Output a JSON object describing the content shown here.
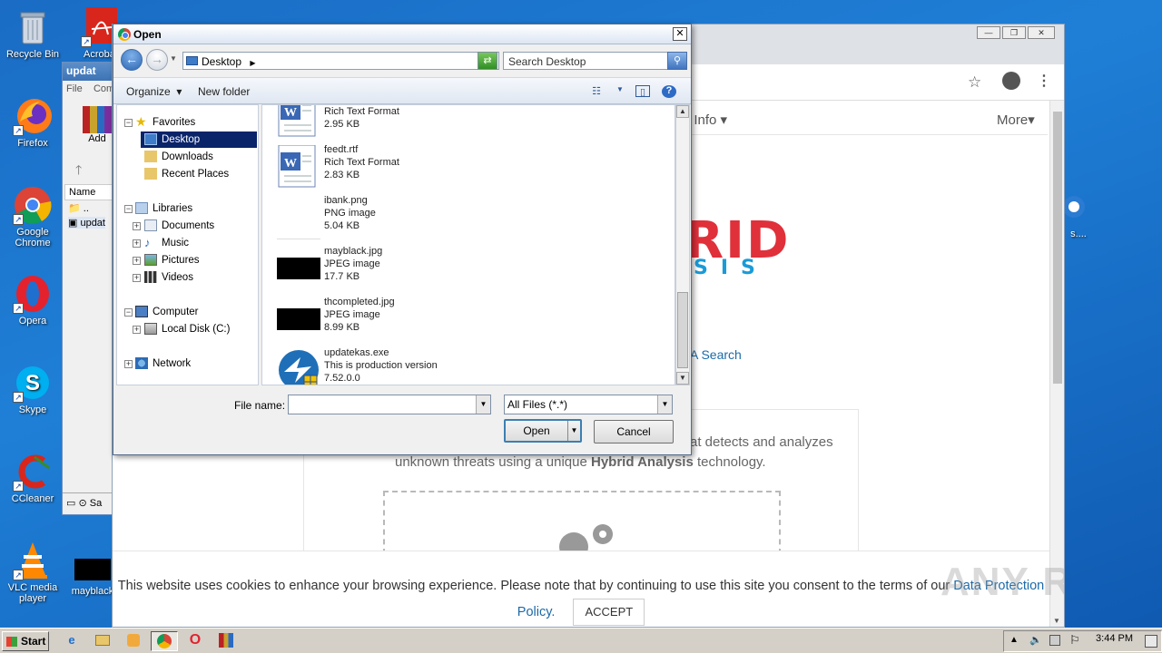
{
  "desktop": {
    "icons": [
      {
        "label": "Recycle Bin"
      },
      {
        "label": "Acrobat"
      },
      {
        "label": "Firefox"
      },
      {
        "label": "Google Chrome"
      },
      {
        "label": "Opera"
      },
      {
        "label": "Skype"
      },
      {
        "label": "CCleaner"
      },
      {
        "label": "VLC media player"
      },
      {
        "label": "mayblack"
      }
    ]
  },
  "winrar": {
    "title": "updat",
    "menu": [
      "File",
      "Com"
    ],
    "add_label": "Add",
    "col_name": "Name",
    "row1": "..",
    "row2": "updat",
    "status": "Sa"
  },
  "browser": {
    "nav_item": "t Info",
    "more": "More",
    "logo_text": "RID",
    "logo_sub": "SIS",
    "search_link": "A Search",
    "desc_line1": "at detects and analyzes",
    "desc_line2a": "unknown threats using a unique ",
    "desc_bold": "Hybrid Analysis",
    "desc_line2b": " technology.",
    "cookie_text": "This website uses cookies to enhance your browsing experience. Please note that by continuing to use this site you consent to the terms of our ",
    "cookie_link": "Data Protection Policy.",
    "accept": "ACCEPT",
    "watermark": "ANY RUN"
  },
  "dialog": {
    "title": "Open",
    "location": "Desktop",
    "search_placeholder": "Search Desktop",
    "organize": "Organize",
    "new_folder": "New folder",
    "tree": {
      "favorites": "Favorites",
      "desktop": "Desktop",
      "downloads": "Downloads",
      "recent": "Recent Places",
      "libraries": "Libraries",
      "documents": "Documents",
      "music": "Music",
      "pictures": "Pictures",
      "videos": "Videos",
      "computer": "Computer",
      "local_disk": "Local Disk (C:)",
      "network": "Network"
    },
    "files": [
      {
        "name": "",
        "type": "Rich Text Format",
        "size": "2.95 KB",
        "kind": "rtf"
      },
      {
        "name": "feedt.rtf",
        "type": "Rich Text Format",
        "size": "2.83 KB",
        "kind": "rtf"
      },
      {
        "name": "ibank.png",
        "type": "PNG image",
        "size": "5.04 KB",
        "kind": "png"
      },
      {
        "name": "mayblack.jpg",
        "type": "JPEG image",
        "size": "17.7 KB",
        "kind": "jpg"
      },
      {
        "name": "thcompleted.jpg",
        "type": "JPEG image",
        "size": "8.99 KB",
        "kind": "jpg"
      },
      {
        "name": "updatekas.exe",
        "type": "This is production version",
        "size": "7.52.0.0",
        "kind": "exe"
      }
    ],
    "file_name_label": "File name:",
    "file_name_value": "",
    "file_type": "All Files (*.*)",
    "open_btn": "Open",
    "cancel_btn": "Cancel"
  },
  "taskbar": {
    "start": "Start",
    "time": "3:44 PM"
  }
}
